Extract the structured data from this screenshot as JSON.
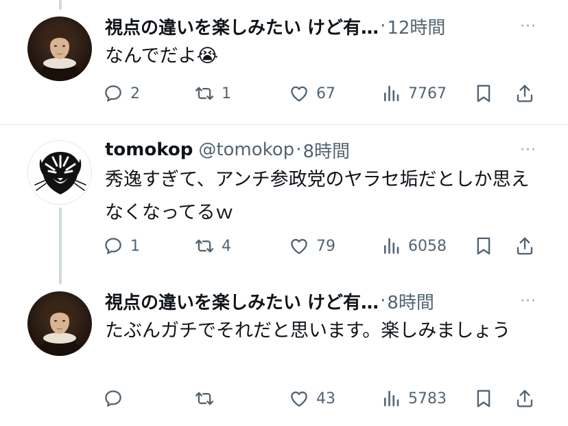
{
  "tweets": [
    {
      "name": "視点の違いを楽しみたい けど有…",
      "handle": "",
      "separator": "·",
      "time": "12時間",
      "text": "なんでだよ😭",
      "replies": "2",
      "retweets": "1",
      "likes": "67",
      "views": "7767"
    },
    {
      "name": "tomokop",
      "handle": "@tomokop",
      "separator": "·",
      "time": "8時間",
      "text": "秀逸すぎて、アンチ参政党のヤラセ垢だとしか思えなくなってるｗ",
      "replies": "1",
      "retweets": "4",
      "likes": "79",
      "views": "6058"
    },
    {
      "name": "視点の違いを楽しみたい けど有…",
      "handle": "",
      "separator": "·",
      "time": "8時間",
      "text": "たぶんガチでそれだと思います。楽しみましょう",
      "replies": "",
      "retweets": "",
      "likes": "43",
      "views": "5783"
    }
  ],
  "more_glyph": "···",
  "icons": {
    "reply": "reply-icon",
    "retweet": "retweet-icon",
    "like": "heart-icon",
    "views": "views-icon",
    "bookmark": "bookmark-icon",
    "share": "share-icon"
  },
  "colors": {
    "text": "#0f1419",
    "secondary": "#536471",
    "thread_line": "#cfd9de",
    "divider": "#e6ecf0"
  }
}
